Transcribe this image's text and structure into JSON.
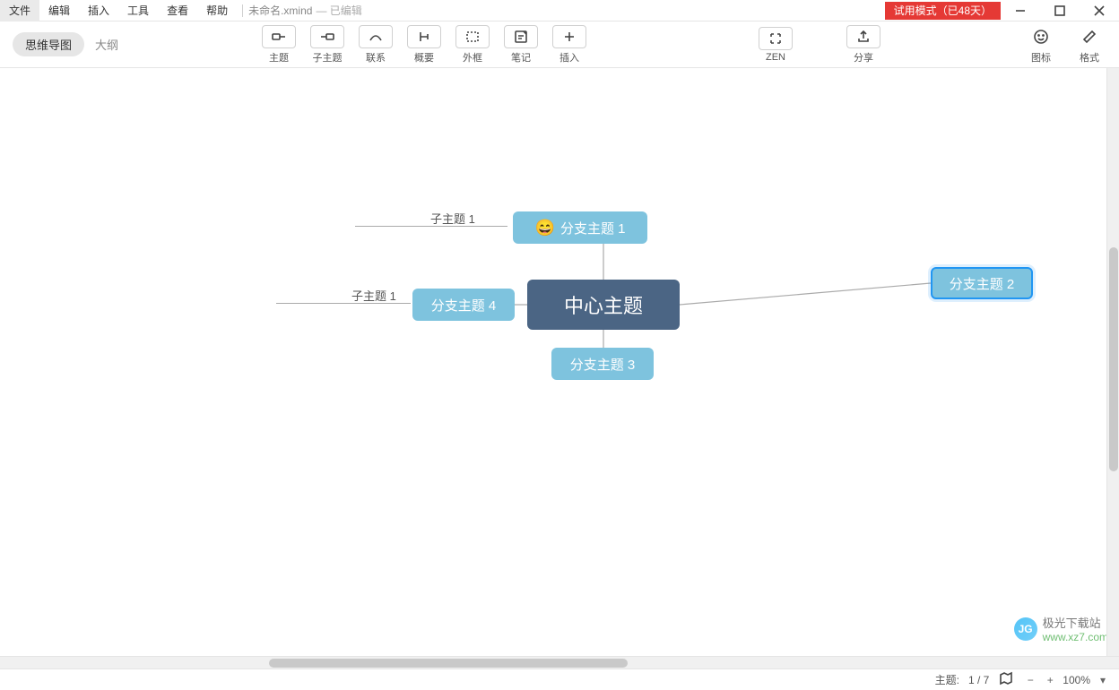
{
  "menu": {
    "file": "文件",
    "edit": "编辑",
    "insert": "插入",
    "tools": "工具",
    "view": "查看",
    "help": "帮助"
  },
  "doc": {
    "title": "未命名.xmind",
    "status": "— 已编辑"
  },
  "trial": "试用模式（已48天）",
  "views": {
    "mindmap": "思维导图",
    "outline": "大纲"
  },
  "tools": {
    "topic": "主题",
    "subtopic": "子主题",
    "relationship": "联系",
    "summary": "概要",
    "boundary": "外框",
    "note": "笔记",
    "insert": "插入",
    "zen": "ZEN",
    "share": "分享",
    "markers": "图标",
    "format": "格式"
  },
  "nodes": {
    "central": "中心主题",
    "b1": "分支主题 1",
    "b2": "分支主题 2",
    "b3": "分支主题 3",
    "b4": "分支主题 4",
    "sub1": "子主题 1",
    "sub2": "子主题 1",
    "emoji": "😄"
  },
  "status": {
    "topic_count_label": "主题:",
    "topic_count": "1 / 7",
    "zoom": "100%"
  },
  "watermark": {
    "name": "极光下载站",
    "url": "www.xz7.com"
  }
}
